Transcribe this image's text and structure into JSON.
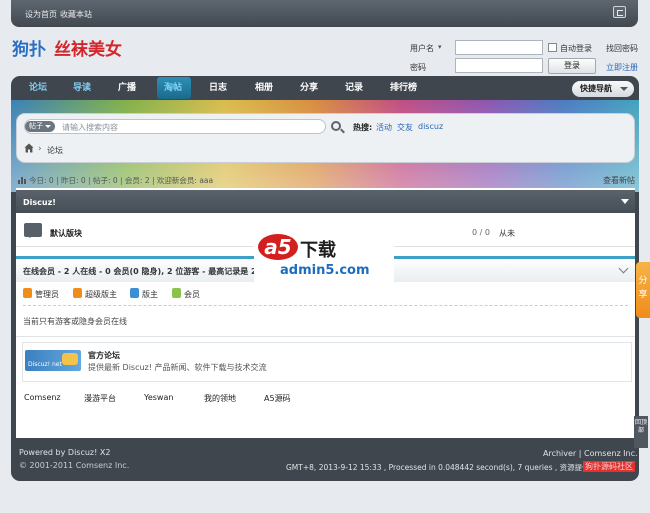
{
  "topbar": {
    "set_home": "设为首页",
    "bookmark": "收藏本站"
  },
  "header": {
    "logo_part1": "狗扑",
    "logo_part2": "丝袜美女",
    "username_label": "用户名",
    "password_label": "密码",
    "autologin_label": "自动登录",
    "forgot_label": "找回密码",
    "login_button": "登录",
    "register_link": "立即注册"
  },
  "nav": {
    "items": [
      "论坛",
      "导读",
      "广播",
      "淘帖",
      "日志",
      "相册",
      "分享",
      "记录",
      "排行榜"
    ],
    "quick_nav": "快捷导航"
  },
  "search": {
    "type_label": "帖子",
    "placeholder": "请输入搜索内容",
    "hot_label": "热搜:",
    "hot_words": [
      "活动",
      "交友",
      "discuz"
    ]
  },
  "breadcrumb": {
    "current": "论坛"
  },
  "stats": {
    "text": "今日: 0 | 昨日: 0 | 帖子: 0 | 会员: 2 | 欢迎新会员: aaa",
    "new_posts": "查看新帖"
  },
  "category": {
    "title": "Discuz!"
  },
  "forum": {
    "name": "默认版块",
    "counts": "0 / 0",
    "last_post": "从未"
  },
  "online": {
    "summary": "在线会员 - 2 人在线 - 0 会员(0 隐身), 2 位游客 - 最高记录是 2 于",
    "roles": [
      {
        "label": "管理员",
        "color": "#f08c1a"
      },
      {
        "label": "超级版主",
        "color": "#f08c1a"
      },
      {
        "label": "版主",
        "color": "#3a8fd5"
      },
      {
        "label": "会员",
        "color": "#8bc34a"
      }
    ],
    "hidden_note": "当前只有游客或隐身会员在线"
  },
  "links": {
    "official_name": "官方论坛",
    "official_desc": "提供最新 Discuz! 产品新闻、软件下载与技术交流",
    "logo_text": "Discuz! net",
    "friend_links": [
      "Comsenz",
      "漫游平台",
      "Yeswan",
      "我的领地",
      "A5源码"
    ]
  },
  "footer": {
    "powered": "Powered by Discuz! X2",
    "copyright": "© 2001-2011 Comsenz Inc.",
    "archiver": "Archiver | Comsenz Inc.",
    "process": "GMT+8, 2013-9-12 15:33 , Processed in 0.048442 second(s), 7 queries , 资源提供：",
    "provider": "狗扑源码社区"
  },
  "side": {
    "share": "分享",
    "to_top": "回顶部"
  },
  "watermark": {
    "a": "a5",
    "b": "下载",
    "c": "admin5.com"
  }
}
